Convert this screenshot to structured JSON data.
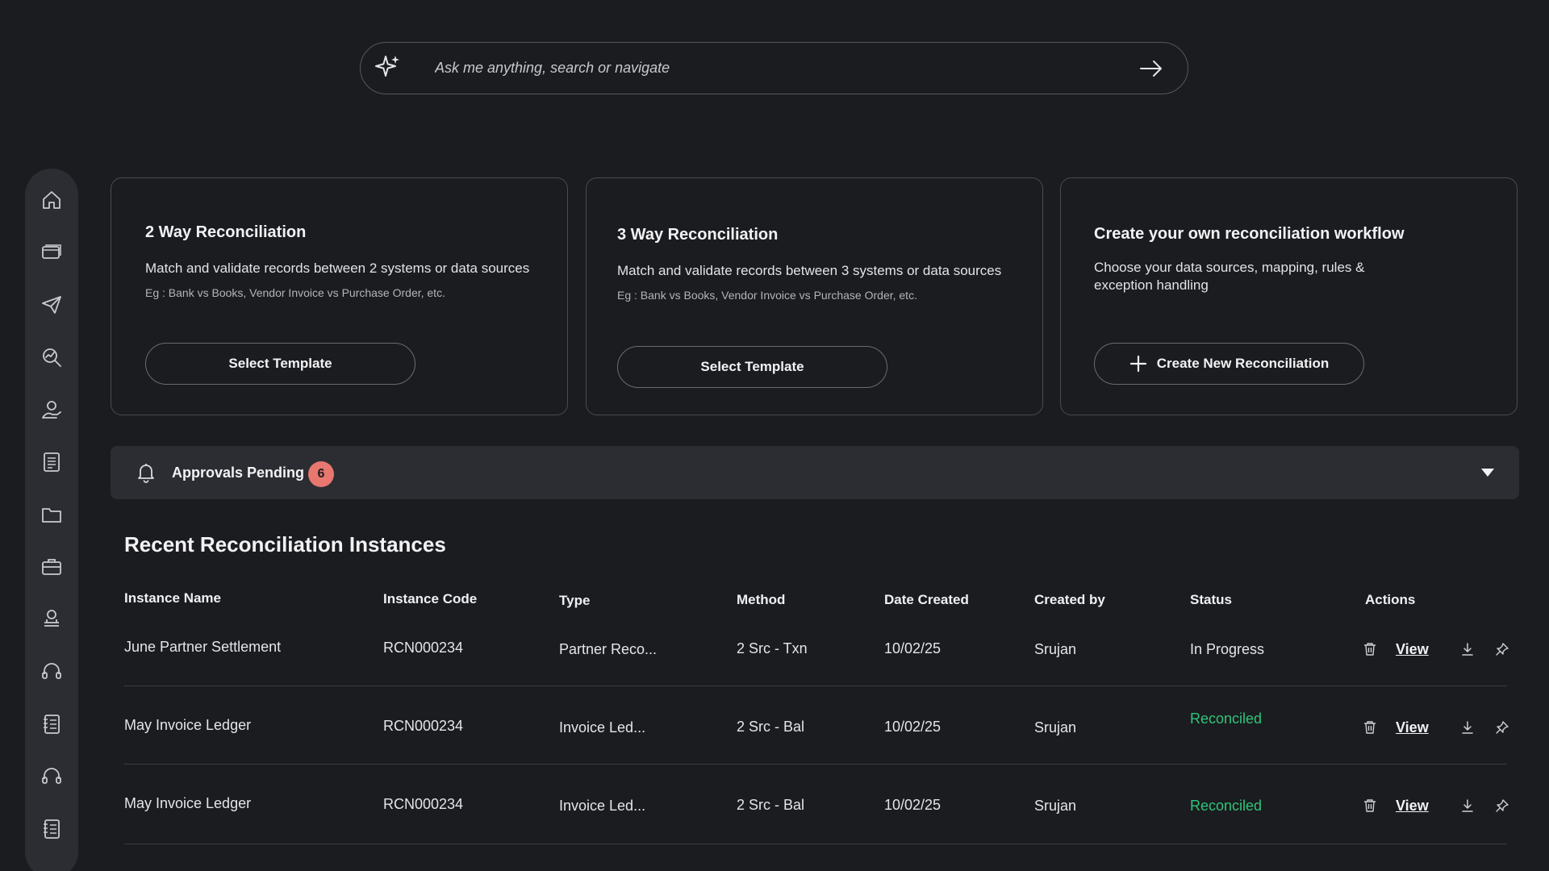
{
  "search": {
    "placeholder": "Ask me anything, search or navigate"
  },
  "sidebar": {
    "items": [
      {
        "icon": "home-icon"
      },
      {
        "icon": "card-icon"
      },
      {
        "icon": "send-icon"
      },
      {
        "icon": "search-chart-icon"
      },
      {
        "icon": "money-hand-icon"
      },
      {
        "icon": "document-list-icon"
      },
      {
        "icon": "folder-icon"
      },
      {
        "icon": "briefcase-icon"
      },
      {
        "icon": "coin-hand-icon"
      },
      {
        "icon": "headset-icon"
      },
      {
        "icon": "ledger-icon"
      },
      {
        "icon": "headset-icon"
      },
      {
        "icon": "ledger-icon"
      }
    ]
  },
  "cards": [
    {
      "title": "2 Way Reconciliation",
      "description": "Match and validate records between 2 systems or data sources",
      "example": "Eg : Bank vs Books, Vendor Invoice vs Purchase Order, etc.",
      "button": "Select Template"
    },
    {
      "title": "3 Way Reconciliation",
      "description": "Match and validate records between 3 systems or data sources",
      "example": "Eg : Bank vs Books, Vendor Invoice vs Purchase Order, etc.",
      "button": "Select Template"
    },
    {
      "title": "Create your own reconciliation workflow",
      "description": "Choose your data sources, mapping, rules & exception handling",
      "button": "Create New Reconciliation"
    }
  ],
  "approvals": {
    "label": "Approvals Pending",
    "count": "6"
  },
  "recent": {
    "title": "Recent Reconciliation Instances",
    "columns": [
      "Instance Name",
      "Instance Code",
      "Type",
      "Method",
      "Date Created",
      "Created by",
      "Status",
      "Actions"
    ],
    "rows": [
      {
        "name": "June Partner Settlement",
        "code": "RCN000234",
        "type": "Partner Reco...",
        "method": "2 Src - Txn",
        "date": "10/02/25",
        "created_by": "Srujan",
        "status": "In Progress",
        "view": "View"
      },
      {
        "name": "May Invoice Ledger",
        "code": "RCN000234",
        "type": "Invoice Led...",
        "method": "2 Src - Bal",
        "date": "10/02/25",
        "created_by": "Srujan",
        "status": "Reconciled",
        "view": "View"
      },
      {
        "name": "May Invoice Ledger",
        "code": "RCN000234",
        "type": "Invoice Led...",
        "method": "2 Src - Bal",
        "date": "10/02/25",
        "created_by": "Srujan",
        "status": "Reconciled",
        "view": "View"
      }
    ]
  },
  "colors": {
    "background": "#1b1c20",
    "panel": "#2c2d32",
    "success": "#2fc47a",
    "badge": "#e8776f"
  }
}
